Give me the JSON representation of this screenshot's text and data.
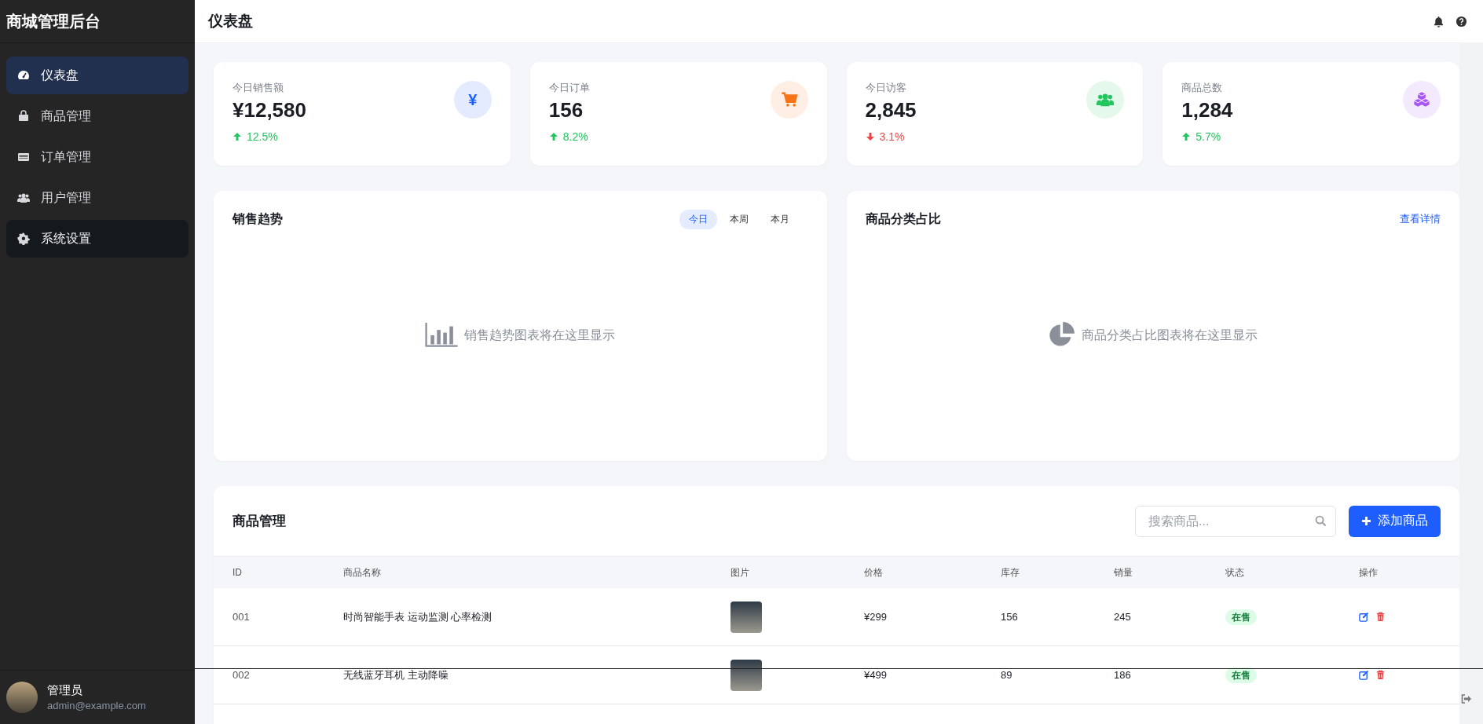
{
  "sidebar": {
    "brand": "商城管理后台",
    "items": [
      {
        "label": "仪表盘",
        "selected": true,
        "hovered": false
      },
      {
        "label": "商品管理",
        "selected": false,
        "hovered": false
      },
      {
        "label": "订单管理",
        "selected": false,
        "hovered": false
      },
      {
        "label": "用户管理",
        "selected": false,
        "hovered": false
      },
      {
        "label": "系统设置",
        "selected": false,
        "hovered": true
      }
    ],
    "user": {
      "name": "管理员",
      "email": "admin@example.com"
    }
  },
  "header": {
    "title": "仪表盘"
  },
  "stats": [
    {
      "label": "今日销售额",
      "value": "¥12,580",
      "change": "12.5%",
      "kind": "up",
      "icon_text": "¥",
      "color": "#1e5eff"
    },
    {
      "label": "今日订单",
      "value": "156",
      "change": "8.2%",
      "kind": "up",
      "color": "#f97316"
    },
    {
      "label": "今日访客",
      "value": "2,845",
      "change": "3.1%",
      "kind": "down",
      "color": "#22c55e"
    },
    {
      "label": "商品总数",
      "value": "1,284",
      "change": "5.7%",
      "kind": "up",
      "color": "#a855f7"
    }
  ],
  "charts": [
    {
      "title": "销售趋势",
      "kind": "tabs",
      "tabs": [
        {
          "label": "今日",
          "selected": true
        },
        {
          "label": "本周",
          "selected": false
        },
        {
          "label": "本月",
          "selected": false
        }
      ],
      "placeholder": "销售趋势图表将在这里显示"
    },
    {
      "title": "商品分类占比",
      "kind": "link",
      "link": "查看详情",
      "placeholder": "商品分类占比图表将在这里显示"
    }
  ],
  "products": {
    "title": "商品管理",
    "search": {
      "placeholder": "搜索商品..."
    },
    "add_button": "添加商品",
    "columns": [
      "ID",
      "商品名称",
      "图片",
      "价格",
      "库存",
      "销量",
      "状态",
      "操作"
    ],
    "rows": [
      {
        "id": "001",
        "name": "时尚智能手表 运动监测 心率检测",
        "price": "¥299",
        "stock": "156",
        "sales": "245",
        "status": "在售"
      },
      {
        "id": "002",
        "name": "无线蓝牙耳机 主动降噪",
        "price": "¥499",
        "stock": "89",
        "sales": "186",
        "status": "在售"
      }
    ]
  }
}
